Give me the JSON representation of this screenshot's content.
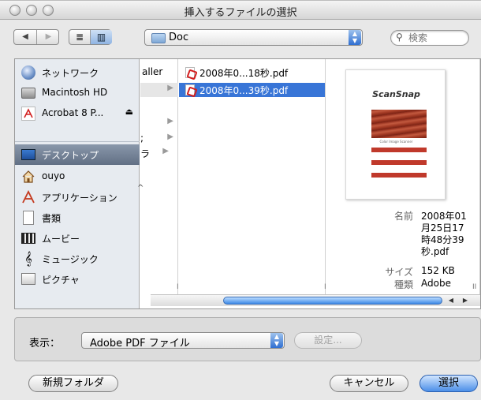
{
  "window": {
    "title": "挿入するファイルの選択"
  },
  "toolbar": {
    "back_arrow": "◀",
    "forward_arrow": "▶",
    "list_view_icon": "≣",
    "column_view_icon": "▥",
    "path_label": "Doc",
    "search_placeholder": "検索"
  },
  "sidebar": {
    "items": [
      {
        "label": "ネットワーク",
        "icon": "network-icon"
      },
      {
        "label": "Macintosh HD",
        "icon": "hard-disk-icon"
      },
      {
        "label": "Acrobat 8 P...",
        "icon": "acrobat-disk-icon",
        "eject": "⏏"
      },
      {
        "label": "デスクトップ",
        "icon": "desktop-icon",
        "selected": true
      },
      {
        "label": "ouyo",
        "icon": "home-icon"
      },
      {
        "label": "アプリケーション",
        "icon": "applications-icon"
      },
      {
        "label": "書類",
        "icon": "documents-icon"
      },
      {
        "label": "ムービー",
        "icon": "movies-icon"
      },
      {
        "label": "ミュージック",
        "icon": "music-icon"
      },
      {
        "label": "ピクチャ",
        "icon": "pictures-icon"
      }
    ]
  },
  "columns": {
    "col1": [
      "aller",
      "",
      "",
      "",
      "",
      ";",
      "ラ"
    ],
    "col2": [
      {
        "name": "2008年0...18秒.pdf",
        "selected": false
      },
      {
        "name": "2008年0...39秒.pdf",
        "selected": true
      }
    ]
  },
  "preview": {
    "logo": "ScanSnap",
    "caption": "Color Image Scanner",
    "meta": {
      "name_label": "名前",
      "name_value": [
        "2008年01",
        "月25日17",
        "時48分39",
        "秒.pdf"
      ],
      "size_label": "サイズ",
      "size_value": "152 KB",
      "kind_label": "種類",
      "kind_value": "Adobe"
    }
  },
  "options": {
    "show_label": "表示：",
    "format_value": "Adobe PDF ファイル",
    "settings_label": "設定..."
  },
  "buttons": {
    "new_folder": "新規フォルダ",
    "cancel": "キャンセル",
    "choose": "選択"
  },
  "colors": {
    "selection": "#3875d7",
    "sidebar_selected": "#616f84",
    "accent": "#2f6fd1"
  }
}
